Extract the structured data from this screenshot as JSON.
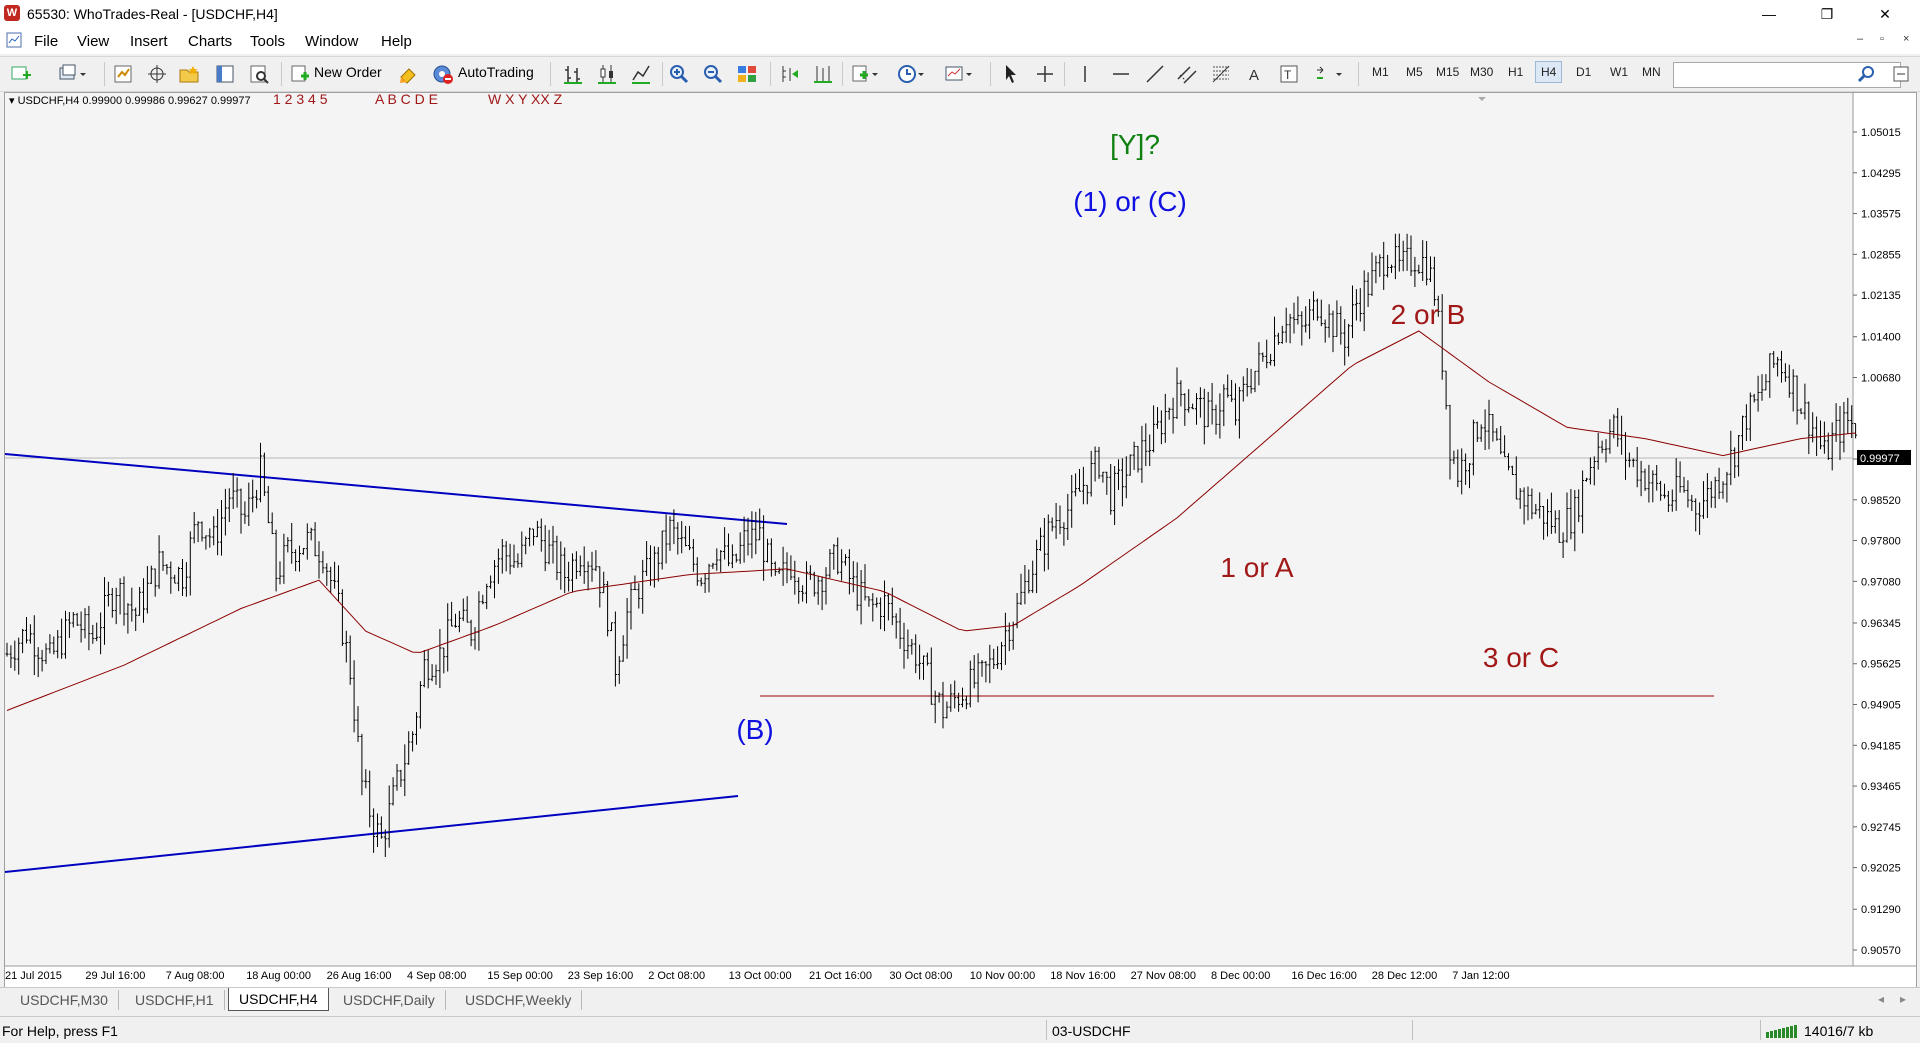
{
  "window": {
    "title": "65530: WhoTrades-Real - [USDCHF,H4]",
    "app_icon_letter": "W",
    "controls": {
      "minimize": "—",
      "restore": "❐",
      "close": "✕"
    }
  },
  "menu": {
    "items": [
      "File",
      "View",
      "Insert",
      "Charts",
      "Tools",
      "Window",
      "Help"
    ],
    "mdi": {
      "minimize": "–",
      "restore": "▫",
      "close": "×"
    }
  },
  "toolbar": {
    "new_order": "New Order",
    "autotrading": "AutoTrading",
    "timeframes": [
      "M1",
      "M5",
      "M15",
      "M30",
      "H1",
      "H4",
      "D1",
      "W1",
      "MN"
    ],
    "active_timeframe": "H4",
    "search_value": ""
  },
  "chart": {
    "header": "USDCHF,H4  0.99900 0.99986 0.99627 0.99977",
    "wave_label_sets": [
      "1 2 3 4 5",
      "A B C D E",
      "W X Y XX Z"
    ],
    "current_price": "0.99977",
    "price_axis": [
      "1.05015",
      "1.04295",
      "1.03575",
      "1.02855",
      "1.02135",
      "1.01400",
      "1.00680",
      "0.99240",
      "0.98520",
      "0.97800",
      "0.97080",
      "0.96345",
      "0.95625",
      "0.94905",
      "0.94185",
      "0.93465",
      "0.92745",
      "0.92025",
      "0.91290",
      "0.90570"
    ],
    "time_axis": [
      "21 Jul 2015",
      "29 Jul 16:00",
      "7 Aug 08:00",
      "18 Aug 00:00",
      "26 Aug 16:00",
      "4 Sep 08:00",
      "15 Sep 00:00",
      "23 Sep 16:00",
      "2 Oct 08:00",
      "13 Oct 00:00",
      "21 Oct 16:00",
      "30 Oct 08:00",
      "10 Nov 00:00",
      "18 Nov 16:00",
      "27 Nov 08:00",
      "8 Dec 00:00",
      "16 Dec 16:00",
      "28 Dec 12:00",
      "7 Jan 12:00"
    ],
    "annotations": {
      "y_top": "[Y]?",
      "one_or_c": "(1) or (C)",
      "b": "(B)",
      "one_or_a": "1 or A",
      "two_or_b": "2 or B",
      "three_or_c": "3 or C"
    },
    "colors": {
      "blue_label": "#1010e0",
      "green_label": "#108010",
      "red_label": "#a01818",
      "trendline": "#0000c0",
      "moving_average": "#8b0000",
      "level_line": "#a00000",
      "bars": "#000000"
    },
    "price_path": [
      [
        0,
        0.958
      ],
      [
        5,
        0.962
      ],
      [
        11,
        0.957
      ],
      [
        17,
        0.964
      ],
      [
        22,
        0.961
      ],
      [
        28,
        0.97
      ],
      [
        33,
        0.965
      ],
      [
        39,
        0.974
      ],
      [
        45,
        0.972
      ],
      [
        49,
        0.982
      ],
      [
        53,
        0.978
      ],
      [
        57,
        0.986
      ],
      [
        61,
        0.982
      ],
      [
        65,
        0.99
      ],
      [
        69,
        0.972
      ],
      [
        72,
        0.976
      ],
      [
        77,
        0.978
      ],
      [
        81,
        0.976
      ],
      [
        85,
        0.966
      ],
      [
        88,
        0.955
      ],
      [
        91,
        0.935
      ],
      [
        94,
        0.928
      ],
      [
        96,
        0.925
      ],
      [
        100,
        0.935
      ],
      [
        104,
        0.944
      ],
      [
        107,
        0.956
      ],
      [
        111,
        0.958
      ],
      [
        115,
        0.964
      ],
      [
        119,
        0.962
      ],
      [
        123,
        0.972
      ],
      [
        127,
        0.976
      ],
      [
        131,
        0.974
      ],
      [
        135,
        0.98
      ],
      [
        139,
        0.976
      ],
      [
        143,
        0.972
      ],
      [
        147,
        0.976
      ],
      [
        151,
        0.974
      ],
      [
        154,
        0.965
      ],
      [
        156,
        0.956
      ],
      [
        159,
        0.965
      ],
      [
        162,
        0.97
      ],
      [
        166,
        0.974
      ],
      [
        170,
        0.98
      ],
      [
        174,
        0.976
      ],
      [
        178,
        0.972
      ],
      [
        182,
        0.977
      ],
      [
        186,
        0.973
      ],
      [
        189,
        0.978
      ],
      [
        193,
        0.979
      ],
      [
        197,
        0.97
      ],
      [
        201,
        0.974
      ],
      [
        205,
        0.97
      ],
      [
        209,
        0.972
      ],
      [
        213,
        0.975
      ],
      [
        217,
        0.97
      ],
      [
        221,
        0.966
      ],
      [
        225,
        0.967
      ],
      [
        229,
        0.962
      ],
      [
        233,
        0.958
      ],
      [
        237,
        0.952
      ],
      [
        240,
        0.948
      ],
      [
        243,
        0.95
      ],
      [
        246,
        0.952
      ],
      [
        250,
        0.954
      ],
      [
        253,
        0.957
      ],
      [
        256,
        0.962
      ],
      [
        259,
        0.966
      ],
      [
        262,
        0.972
      ],
      [
        266,
        0.978
      ],
      [
        269,
        0.982
      ],
      [
        273,
        0.984
      ],
      [
        276,
        0.988
      ],
      [
        280,
        0.992
      ],
      [
        283,
        0.986
      ],
      [
        287,
        0.99
      ],
      [
        291,
        0.994
      ],
      [
        294,
        0.996
      ],
      [
        298,
        1.002
      ],
      [
        301,
        1.004
      ],
      [
        305,
        1.002
      ],
      [
        309,
        0.999
      ],
      [
        312,
        1.004
      ],
      [
        315,
        1.0
      ],
      [
        318,
        1.006
      ],
      [
        322,
        1.01
      ],
      [
        325,
        1.014
      ],
      [
        328,
        1.018
      ],
      [
        332,
        1.015
      ],
      [
        336,
        1.02
      ],
      [
        339,
        1.017
      ],
      [
        343,
        1.014
      ],
      [
        346,
        1.02
      ],
      [
        350,
        1.024
      ],
      [
        354,
        1.029
      ],
      [
        357,
        1.026
      ],
      [
        361,
        1.028
      ],
      [
        364,
        1.027
      ],
      [
        366,
        1.022
      ],
      [
        368,
        1.01
      ],
      [
        370,
        0.995
      ],
      [
        372,
        0.99
      ],
      [
        375,
        0.994
      ],
      [
        378,
        1.0
      ],
      [
        381,
        0.996
      ],
      [
        384,
        0.99
      ],
      [
        387,
        0.987
      ],
      [
        391,
        0.984
      ],
      [
        395,
        0.982
      ],
      [
        398,
        0.98
      ],
      [
        402,
        0.983
      ],
      [
        405,
        0.99
      ],
      [
        408,
        0.995
      ],
      [
        412,
        0.998
      ],
      [
        415,
        0.993
      ],
      [
        419,
        0.99
      ],
      [
        422,
        0.988
      ],
      [
        426,
        0.985
      ],
      [
        429,
        0.987
      ],
      [
        433,
        0.984
      ],
      [
        436,
        0.986
      ],
      [
        440,
        0.99
      ],
      [
        443,
        0.994
      ],
      [
        446,
        1.0
      ],
      [
        449,
        1.003
      ],
      [
        452,
        1.008
      ],
      [
        454,
        1.01
      ],
      [
        457,
        1.007
      ],
      [
        460,
        1.002
      ],
      [
        463,
        0.998
      ],
      [
        466,
        0.993
      ],
      [
        469,
        0.997
      ],
      [
        472,
        0.999
      ],
      [
        474,
        0.998
      ]
    ],
    "ma_path": [
      [
        0,
        0.948
      ],
      [
        30,
        0.956
      ],
      [
        60,
        0.966
      ],
      [
        80,
        0.971
      ],
      [
        92,
        0.962
      ],
      [
        105,
        0.958
      ],
      [
        125,
        0.963
      ],
      [
        145,
        0.969
      ],
      [
        175,
        0.972
      ],
      [
        200,
        0.973
      ],
      [
        225,
        0.969
      ],
      [
        245,
        0.962
      ],
      [
        258,
        0.963
      ],
      [
        275,
        0.97
      ],
      [
        300,
        0.982
      ],
      [
        325,
        0.997
      ],
      [
        345,
        1.009
      ],
      [
        362,
        1.015
      ],
      [
        380,
        1.006
      ],
      [
        400,
        0.998
      ],
      [
        420,
        0.996
      ],
      [
        440,
        0.993
      ],
      [
        460,
        0.996
      ],
      [
        474,
        0.997
      ]
    ]
  }
}
